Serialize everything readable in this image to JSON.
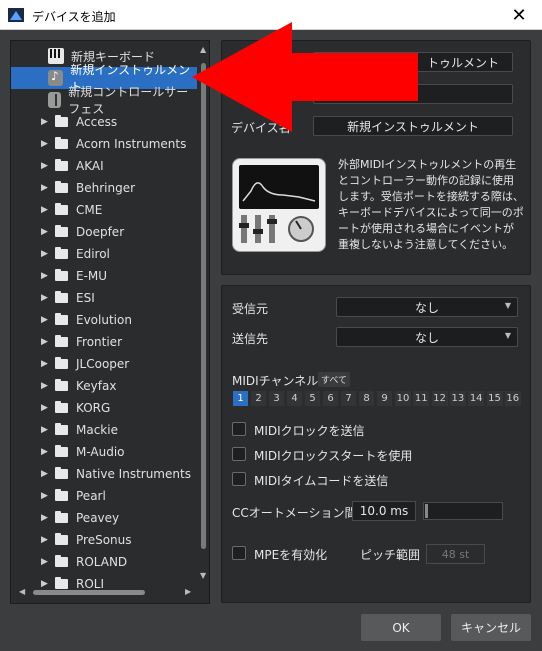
{
  "window": {
    "title": "デバイスを追加"
  },
  "tree": {
    "top_items": [
      {
        "label": "新規キーボード",
        "icon": "keyboard-icon"
      },
      {
        "label": "新規インストゥルメント",
        "icon": "instrument-icon",
        "selected": true
      },
      {
        "label": "新規コントロールサーフェス",
        "icon": "control-surface-icon"
      }
    ],
    "folders": [
      "Access",
      "Acorn Instruments",
      "AKAI",
      "Behringer",
      "CME",
      "Doepfer",
      "Edirol",
      "E-MU",
      "ESI",
      "Evolution",
      "Frontier",
      "JLCooper",
      "Keyfax",
      "KORG",
      "Mackie",
      "M-Audio",
      "Native Instruments",
      "Pearl",
      "Peavey",
      "PreSonus",
      "ROLAND",
      "ROLI"
    ]
  },
  "device": {
    "top_field_value": "トゥルメント",
    "name_label": "デバイス名",
    "name_value": "新規インストゥルメント",
    "description": "外部MIDIインストゥルメントの再生とコントローラー動作の記録に使用します。受信ポートを接続する際は、キーボードデバイスによって同一のポートが使用される場合にイベントが重複しないよう注意してください。"
  },
  "routing": {
    "receive_label": "受信元",
    "receive_value": "なし",
    "send_label": "送信先",
    "send_value": "なし"
  },
  "midi": {
    "channel_label": "MIDIチャンネル",
    "all_label": "すべて",
    "channels": [
      "1",
      "2",
      "3",
      "4",
      "5",
      "6",
      "7",
      "8",
      "9",
      "10",
      "11",
      "12",
      "13",
      "14",
      "15",
      "16"
    ],
    "active_channel": "1",
    "send_clock_label": "MIDIクロックを送信",
    "clock_start_label": "MIDIクロックスタートを使用",
    "send_timecode_label": "MIDIタイムコードを送信"
  },
  "cc": {
    "label": "CCオートメーション間隔",
    "value": "10.0 ms"
  },
  "mpe": {
    "enable_label": "MPEを有効化",
    "pitch_label": "ピッチ範囲",
    "pitch_value": "48 st"
  },
  "buttons": {
    "ok": "OK",
    "cancel": "キャンセル"
  },
  "colors": {
    "selection": "#2b6fc4",
    "arrow": "#ff0000",
    "background": "#3c3d3f"
  }
}
